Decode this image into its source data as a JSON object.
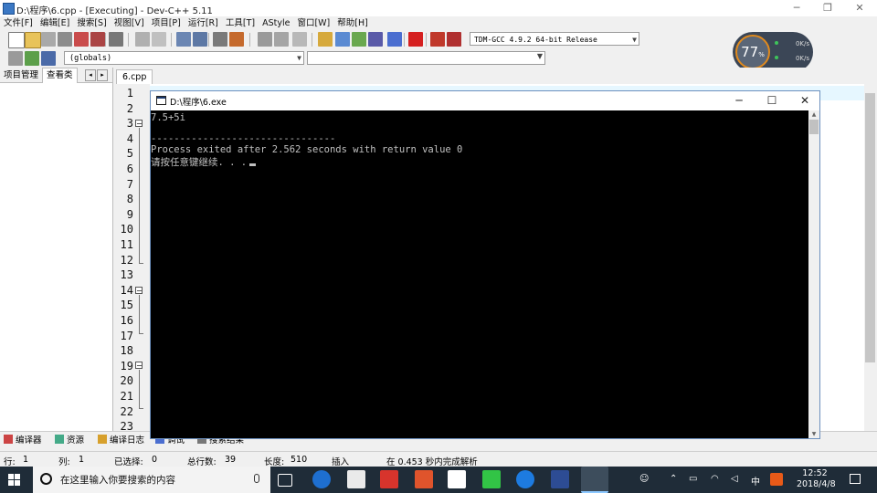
{
  "window": {
    "title": "D:\\程序\\6.cpp - [Executing] - Dev-C++ 5.11",
    "minimize": "─",
    "maximize": "❐",
    "close": "✕"
  },
  "menu": [
    "文件[F]",
    "编辑[E]",
    "搜索[S]",
    "视图[V]",
    "项目[P]",
    "运行[R]",
    "工具[T]",
    "AStyle",
    "窗口[W]",
    "帮助[H]"
  ],
  "toolbar": {
    "compiler": "TDM-GCC 4.9.2 64-bit Release",
    "globals": "(globals)"
  },
  "perf": {
    "cpu_value": "77",
    "cpu_unit": "%",
    "up": "0K/s",
    "down": "0K/s"
  },
  "left_panel": {
    "tabs": [
      "项目管理",
      "查看类"
    ],
    "prev": "◂",
    "next": "▸"
  },
  "editor": {
    "tab": "6.cpp",
    "line_numbers": [
      "1",
      "2",
      "3",
      "4",
      "5",
      "6",
      "7",
      "8",
      "9",
      "10",
      "11",
      "12",
      "13",
      "14",
      "15",
      "16",
      "17",
      "18",
      "19",
      "20",
      "21",
      "22",
      "23"
    ]
  },
  "bottom_tabs": [
    "编译器",
    "资源",
    "编译日志",
    "调试",
    "搜索结果"
  ],
  "status": {
    "row_label": "行:",
    "row": "1",
    "col_label": "列:",
    "col": "1",
    "sel_label": "已选择:",
    "sel": "0",
    "total_label": "总行数:",
    "total": "39",
    "len_label": "长度:",
    "len": "510",
    "mode": "插入",
    "parse": "在 0.453 秒内完成解析"
  },
  "console": {
    "title": "D:\\程序\\6.exe",
    "minimize": "─",
    "maximize": "☐",
    "close": "✕",
    "lines": [
      "7.5+5i",
      "",
      "--------------------------------",
      "Process exited after 2.562 seconds with return value 0",
      "请按任意键继续. . ."
    ]
  },
  "taskbar": {
    "search_placeholder": "在这里输入你要搜索的内容",
    "tray_lang": "中",
    "time": "12:52",
    "date": "2018/4/8"
  },
  "colors": {
    "console_bg": "#000000",
    "console_text": "#c0c0c0",
    "taskbar_bg": "#1f2c38",
    "gauge_ring": "#e08a1e"
  }
}
